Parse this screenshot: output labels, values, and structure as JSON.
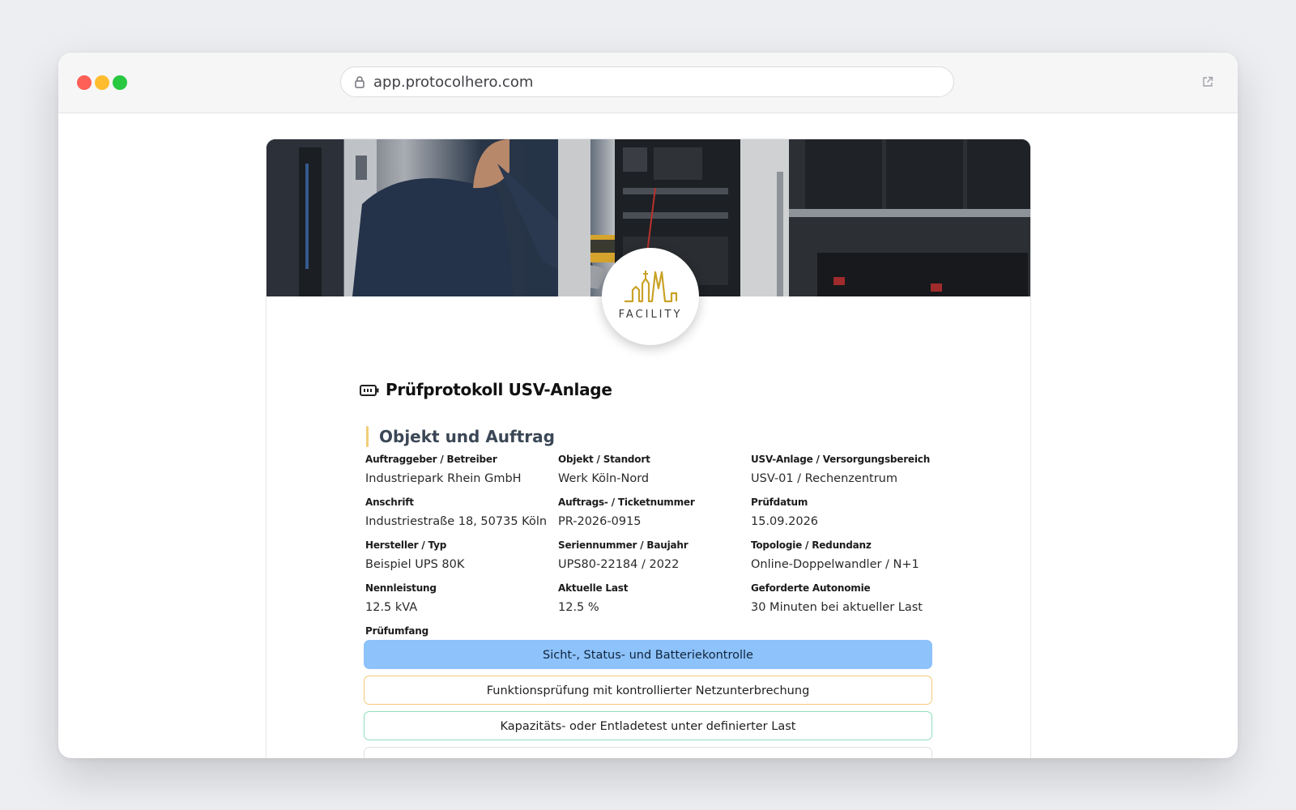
{
  "browser": {
    "url": "app.protocolhero.com"
  },
  "logo": {
    "text": "FACILITY"
  },
  "page": {
    "title": "Prüfprotokoll USV-Anlage",
    "section_title": "Objekt und Auftrag"
  },
  "fields": [
    {
      "label": "Auftraggeber / Betreiber",
      "value": "Industriepark Rhein GmbH"
    },
    {
      "label": "Objekt / Standort",
      "value": "Werk Köln-Nord"
    },
    {
      "label": "USV-Anlage / Versorgungsbereich",
      "value": "USV-01 / Rechenzentrum"
    },
    {
      "label": "Anschrift",
      "value": "Industriestraße 18, 50735 Köln"
    },
    {
      "label": "Auftrags- / Ticketnummer",
      "value": "PR-2026-0915"
    },
    {
      "label": "Prüfdatum",
      "value": "15.09.2026"
    },
    {
      "label": "Hersteller / Typ",
      "value": "Beispiel UPS 80K"
    },
    {
      "label": "Seriennummer / Baujahr",
      "value": "UPS80-22184 / 2022"
    },
    {
      "label": "Topologie / Redundanz",
      "value": "Online-Doppelwandler / N+1"
    },
    {
      "label": "Nennleistung",
      "value": "12.5 kVA"
    },
    {
      "label": "Aktuelle Last",
      "value": "12.5 %"
    },
    {
      "label": "Geforderte Autonomie",
      "value": "30 Minuten bei aktueller Last"
    }
  ],
  "scope": {
    "label": "Prüfumfang",
    "options": [
      {
        "label": "Sicht-, Status- und Batteriekontrolle",
        "selected": true
      },
      {
        "label": "Funktionsprüfung mit kontrollierter Netzunterbrechung",
        "selected": false
      },
      {
        "label": "Kapazitäts- oder Entladetest unter definierter Last",
        "selected": false
      },
      {
        "label": "",
        "selected": false
      }
    ]
  },
  "colors": {
    "accent_selected": "#8dc2fb",
    "border_orange": "#f3c97c",
    "border_green": "#8fe0bd",
    "logo_gold": "#c9a227",
    "section_bar": "#f1cd77"
  }
}
